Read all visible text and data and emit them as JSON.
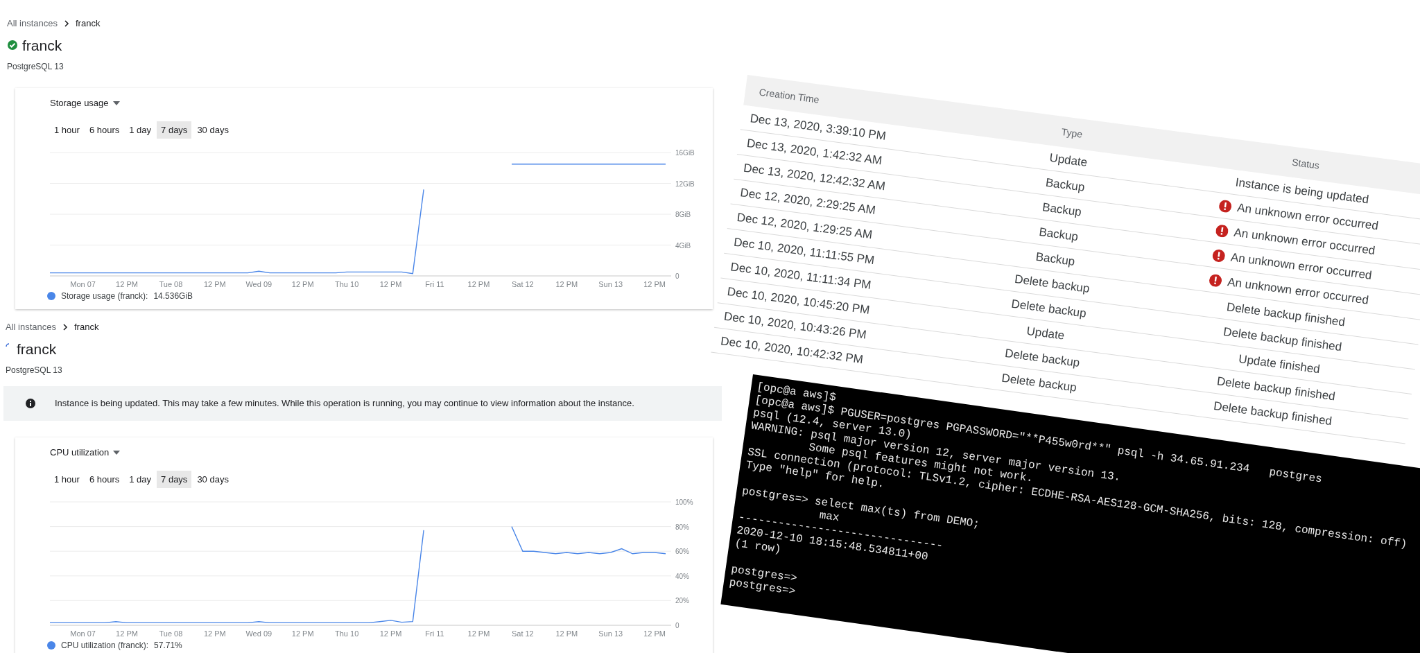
{
  "storage_page": {
    "breadcrumb": [
      "All instances",
      "franck"
    ],
    "title": "franck",
    "updating": false,
    "subtitle": "PostgreSQL 13",
    "chart_card": {
      "metric": "Storage usage",
      "ranges": [
        {
          "label": "1 hour",
          "selected": false
        },
        {
          "label": "6 hours",
          "selected": false
        },
        {
          "label": "1 day",
          "selected": false
        },
        {
          "label": "7 days",
          "selected": true
        },
        {
          "label": "30 days",
          "selected": false
        }
      ],
      "legend": {
        "label": "Storage usage (franck):",
        "value": "14.536GiB"
      },
      "chart_data": {
        "type": "line",
        "categories": [
          null,
          null,
          null,
          "Mon 07",
          null,
          null,
          null,
          "12 PM",
          null,
          null,
          null,
          "Tue 08",
          null,
          null,
          null,
          "12 PM",
          null,
          null,
          null,
          "Wed 09",
          null,
          null,
          null,
          "12 PM",
          null,
          null,
          null,
          "Thu 10",
          null,
          null,
          null,
          "12 PM",
          null,
          null,
          null,
          "Fri 11",
          null,
          null,
          null,
          "12 PM",
          null,
          null,
          null,
          "Sat 12",
          null,
          null,
          null,
          "12 PM",
          null,
          null,
          null,
          "Sun 13",
          null,
          null,
          null,
          "12 PM",
          null
        ],
        "series": [
          {
            "color": "#4a86e8",
            "values": [
              0.4,
              0.4,
              0.4,
              0.4,
              0.4,
              0.4,
              0.4,
              0.4,
              0.4,
              0.4,
              0.4,
              0.4,
              0.4,
              0.4,
              0.4,
              0.4,
              0.4,
              0.4,
              0.4,
              0.6,
              0.4,
              0.4,
              0.4,
              0.4,
              0.4,
              0.4,
              0.4,
              0.5,
              0.5,
              0.5,
              0.5,
              0.5,
              0.5,
              0.3,
              11.2,
              null,
              null,
              null,
              null,
              null,
              null,
              null,
              14.5,
              14.5,
              14.5,
              14.5,
              14.5,
              14.5,
              14.5,
              14.5,
              14.5,
              14.5,
              14.5,
              14.5,
              14.5,
              14.5,
              14.5
            ]
          }
        ],
        "grid": true,
        "ylim": [
          0,
          16
        ],
        "yticks": [
          {
            "value": 0,
            "label": "0"
          },
          {
            "value": 4,
            "label": "4GiB"
          },
          {
            "value": 8,
            "label": "8GiB"
          },
          {
            "value": 12,
            "label": "12GiB"
          },
          {
            "value": 16,
            "label": "16GiB"
          }
        ]
      }
    }
  },
  "cpu_page": {
    "breadcrumb": [
      "All instances",
      "franck"
    ],
    "title": "franck",
    "updating": true,
    "subtitle": "PostgreSQL 13",
    "banner": "Instance is being updated. This may take a few minutes. While this operation is running, you may continue to view information about the instance.",
    "chart_card": {
      "metric": "CPU utilization",
      "ranges": [
        {
          "label": "1 hour",
          "selected": false
        },
        {
          "label": "6 hours",
          "selected": false
        },
        {
          "label": "1 day",
          "selected": false
        },
        {
          "label": "7 days",
          "selected": true
        },
        {
          "label": "30 days",
          "selected": false
        }
      ],
      "legend": {
        "label": "CPU utilization (franck):",
        "value": "57.71%"
      },
      "chart_data": {
        "type": "line",
        "categories": [
          null,
          null,
          null,
          "Mon 07",
          null,
          null,
          null,
          "12 PM",
          null,
          null,
          null,
          "Tue 08",
          null,
          null,
          null,
          "12 PM",
          null,
          null,
          null,
          "Wed 09",
          null,
          null,
          null,
          "12 PM",
          null,
          null,
          null,
          "Thu 10",
          null,
          null,
          null,
          "12 PM",
          null,
          null,
          null,
          "Fri 11",
          null,
          null,
          null,
          "12 PM",
          null,
          null,
          null,
          "Sat 12",
          null,
          null,
          null,
          "12 PM",
          null,
          null,
          null,
          "Sun 13",
          null,
          null,
          null,
          "12 PM",
          null
        ],
        "series": [
          {
            "color": "#4a86e8",
            "values": [
              2,
              2,
              2,
              2,
              2,
              2,
              3,
              2,
              2,
              2,
              2,
              2,
              2,
              2,
              2,
              2,
              2,
              2,
              2,
              3,
              2,
              2,
              2,
              2,
              2,
              2,
              2,
              2,
              2,
              2,
              3,
              4,
              2.5,
              3,
              77,
              null,
              null,
              null,
              null,
              null,
              null,
              null,
              80,
              60,
              60,
              59,
              58,
              59,
              58,
              59,
              58,
              59,
              62,
              58,
              59,
              59,
              58
            ]
          }
        ],
        "grid": true,
        "ylim": [
          0,
          100
        ],
        "yticks": [
          {
            "value": 0,
            "label": "0"
          },
          {
            "value": 20,
            "label": "20%"
          },
          {
            "value": 40,
            "label": "40%"
          },
          {
            "value": 60,
            "label": "60%"
          },
          {
            "value": 80,
            "label": "80%"
          },
          {
            "value": 100,
            "label": "100%"
          }
        ]
      }
    }
  },
  "operations_table": {
    "columns": [
      "Creation Time",
      "Type",
      "Status"
    ],
    "rows": [
      {
        "creation_time": "Dec 13, 2020, 3:39:10 PM",
        "type": "Update",
        "status": "Instance is being updated",
        "kind": "plain"
      },
      {
        "creation_time": "Dec 13, 2020, 1:42:32 AM",
        "type": "Backup",
        "status": "An unknown error occurred",
        "kind": "error"
      },
      {
        "creation_time": "Dec 13, 2020, 12:42:32 AM",
        "type": "Backup",
        "status": "An unknown error occurred",
        "kind": "error"
      },
      {
        "creation_time": "Dec 12, 2020, 2:29:25 AM",
        "type": "Backup",
        "status": "An unknown error occurred",
        "kind": "error"
      },
      {
        "creation_time": "Dec 12, 2020, 1:29:25 AM",
        "type": "Backup",
        "status": "An unknown error occurred",
        "kind": "error"
      },
      {
        "creation_time": "Dec 10, 2020, 11:11:55 PM",
        "type": "Delete backup",
        "status": "Delete backup finished",
        "kind": "plain"
      },
      {
        "creation_time": "Dec 10, 2020, 11:11:34 PM",
        "type": "Delete backup",
        "status": "Delete backup finished",
        "kind": "plain"
      },
      {
        "creation_time": "Dec 10, 2020, 10:45:20 PM",
        "type": "Update",
        "status": "Update finished",
        "kind": "plain"
      },
      {
        "creation_time": "Dec 10, 2020, 10:43:26 PM",
        "type": "Delete backup",
        "status": "Delete backup finished",
        "kind": "plain"
      },
      {
        "creation_time": "Dec 10, 2020, 10:42:32 PM",
        "type": "Delete backup",
        "status": "Delete backup finished",
        "kind": "plain"
      }
    ]
  },
  "terminal": {
    "blocks": [
      [
        "[opc@a aws]$",
        "[opc@a aws]$ PGUSER=postgres PGPASSWORD=\"**P455w0rd**\" psql -h 34.65.91.234   postgres",
        "psql (12.4, server 13.0)",
        "WARNING: psql major version 12, server major version 13.",
        "         Some psql features might not work.",
        "SSL connection (protocol: TLSv1.2, cipher: ECDHE-RSA-AES128-GCM-SHA256, bits: 128, compression: off)",
        "Type \"help\" for help."
      ],
      [
        "postgres=> select max(ts) from DEMO;",
        "            max",
        "-------------------------------",
        "2020-12-10 18:15:48.534811+00",
        "(1 row)"
      ],
      [
        "postgres=>",
        "postgres=>"
      ]
    ]
  }
}
